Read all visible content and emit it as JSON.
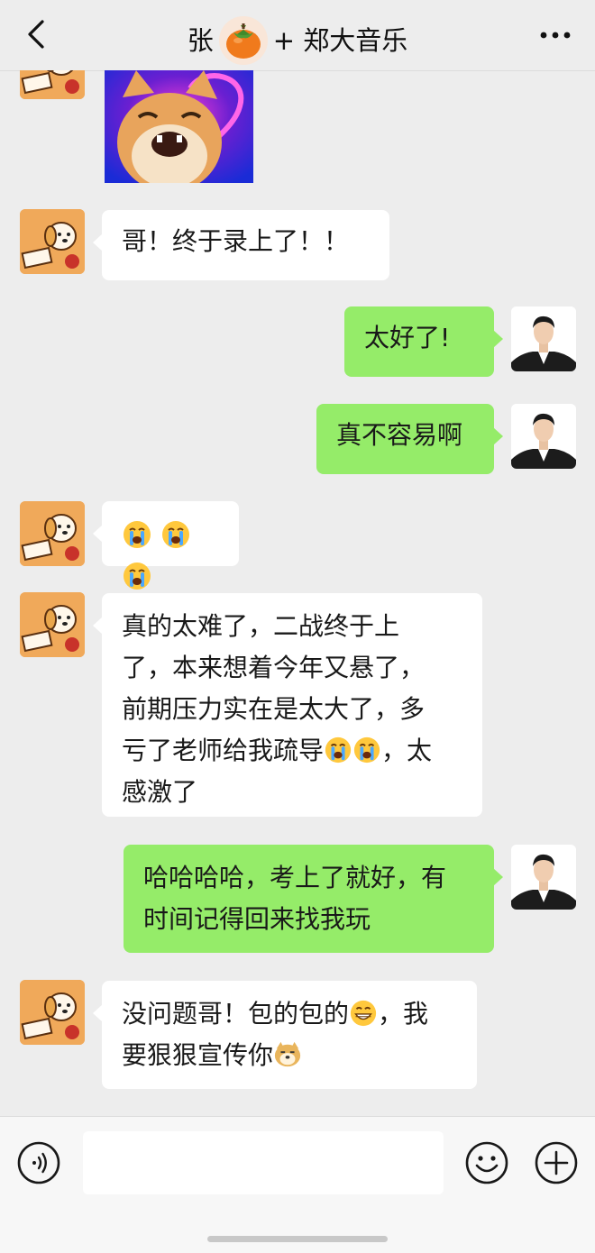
{
  "header": {
    "title_prefix": "张",
    "title_suffix": "+ 郑大音乐",
    "back_icon": "chevron-left-icon",
    "more_icon": "more-dots-icon"
  },
  "messages": [
    {
      "side": "left",
      "type": "sticker",
      "sticker": "laughing-cat-sticker"
    },
    {
      "side": "left",
      "lines": [
        "哥！终于录上了！！"
      ]
    },
    {
      "side": "right",
      "lines": [
        "太好了!"
      ]
    },
    {
      "side": "right",
      "lines": [
        "真不容易啊"
      ]
    },
    {
      "side": "left",
      "emoji_only": [
        "crying-emoji",
        "crying-emoji",
        "crying-emoji"
      ]
    },
    {
      "side": "left",
      "lines": [
        "真的太难了，二战终于上",
        "了，本来想着今年又悬了，",
        "前期压力实在是太大了，多",
        "亏了老师给我疏导",
        "感激了"
      ],
      "line4_tail": "，太",
      "line5_head": ""
    },
    {
      "side": "right",
      "lines": [
        "哈哈哈哈，考上了就好，有",
        "时间记得回来找我玩"
      ]
    },
    {
      "side": "left",
      "lines": [
        "没问题哥！包的包的",
        "，我",
        "要狠狠宣传你"
      ]
    }
  ],
  "msg6": {
    "line1": "真的太难了，二战终于上",
    "line2": "了，本来想着今年又悬了，",
    "line3": "前期压力实在是太大了，多",
    "line4_a": "亏了老师给我疏导",
    "line4_b": "，太",
    "line5": "感激了"
  },
  "msg8": {
    "line1_a": "没问题哥！包的包的",
    "line1_b": "，我",
    "line2": "要狠狠宣传你"
  },
  "input_bar": {
    "voice_icon": "voice-icon",
    "emoji_icon": "smiley-icon",
    "plus_icon": "plus-circle-icon",
    "input_value": ""
  },
  "colors": {
    "background": "#ededed",
    "bubble_self": "#95ec69",
    "bubble_other": "#ffffff"
  }
}
